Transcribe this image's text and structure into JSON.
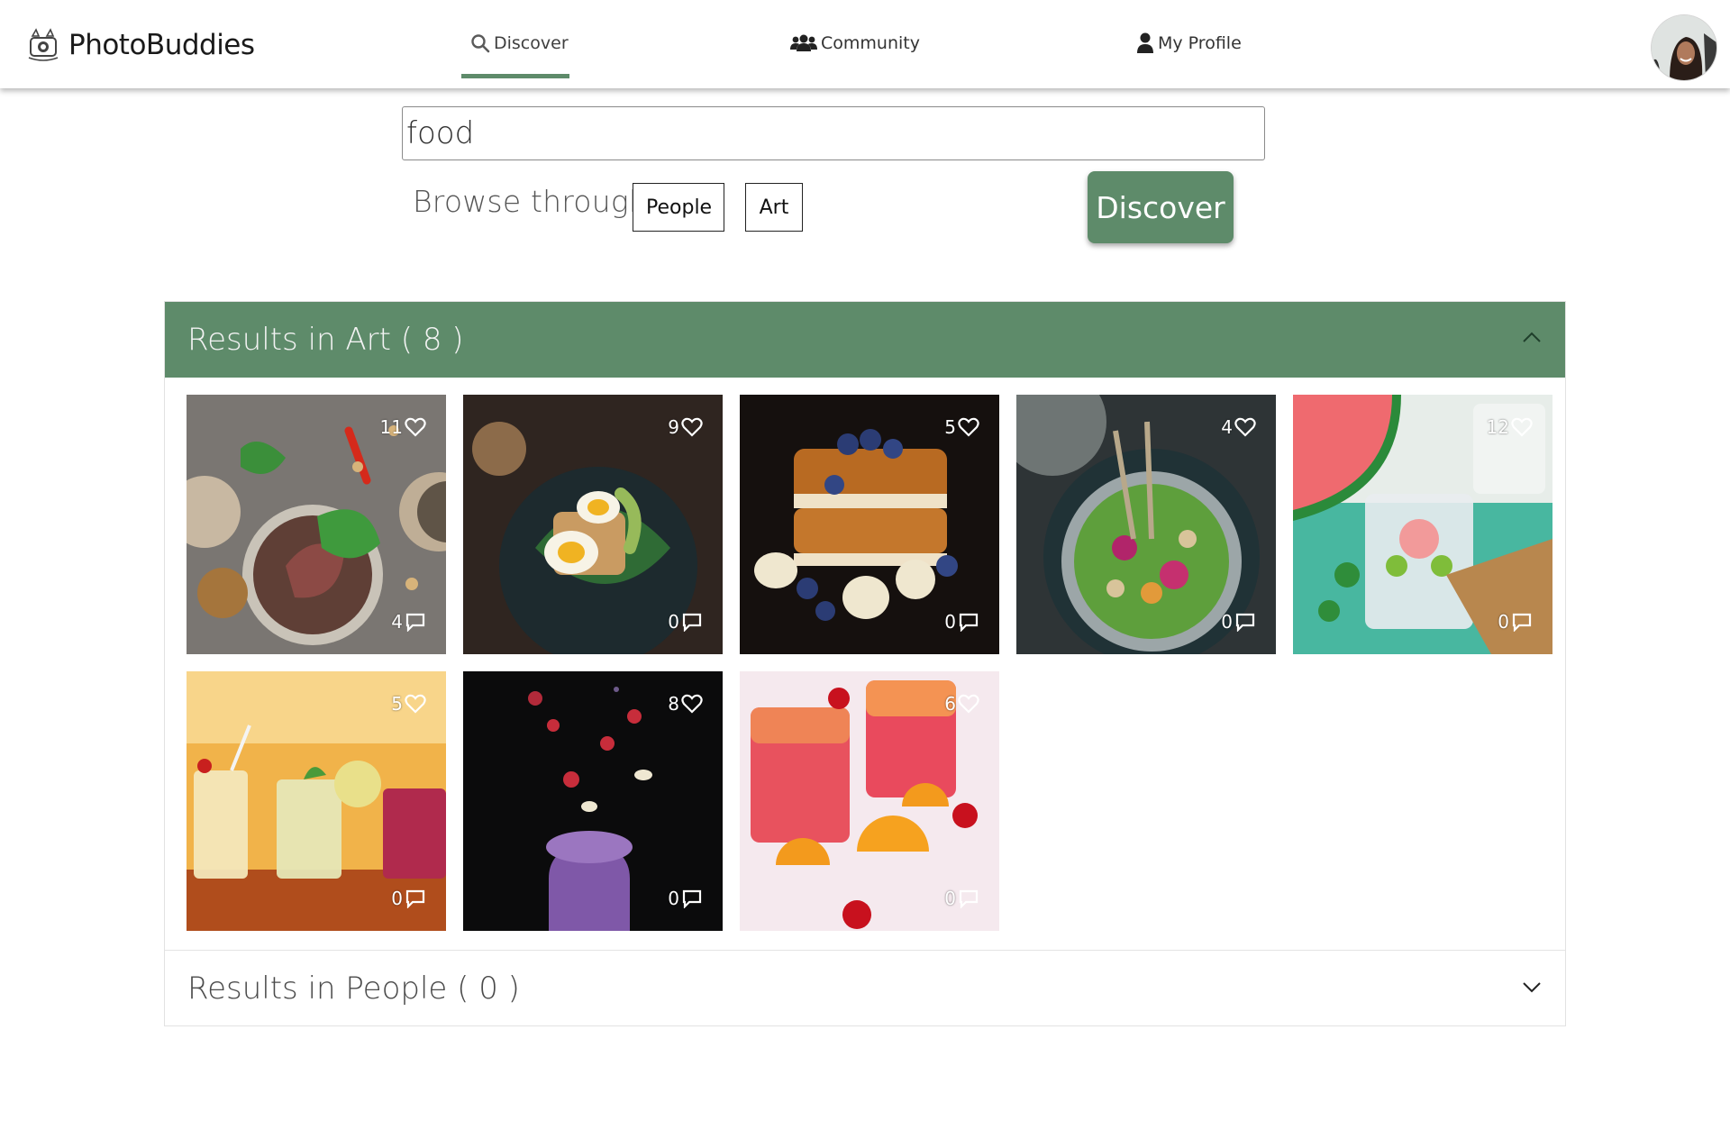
{
  "brand": {
    "name": "PhotoBuddies",
    "logo_icon": "camera-logo-icon"
  },
  "nav": {
    "items": [
      {
        "label": "Discover",
        "icon": "search-icon",
        "active": true
      },
      {
        "label": "Community",
        "icon": "users-icon",
        "active": false
      },
      {
        "label": "My Profile",
        "icon": "user-icon",
        "active": false
      }
    ],
    "accent_color": "#5e8b6a"
  },
  "search": {
    "value": "food",
    "browse_label": "Browse through",
    "filters": [
      "People",
      "Art"
    ],
    "discover_label": "Discover"
  },
  "results": {
    "art": {
      "title": "Results in Art ( 8 )",
      "expanded": true,
      "items": [
        {
          "likes": "11",
          "comments": "4",
          "subject": "steak-salad-bowls"
        },
        {
          "likes": "9",
          "comments": "0",
          "subject": "egg-avocado-toast"
        },
        {
          "likes": "5",
          "comments": "0",
          "subject": "french-toast-blueberries"
        },
        {
          "likes": "4",
          "comments": "0",
          "subject": "green-salad-bowl"
        },
        {
          "likes": "12",
          "comments": "0",
          "subject": "watermelon-drinks"
        },
        {
          "likes": "5",
          "comments": "0",
          "subject": "cocktail-glasses"
        },
        {
          "likes": "8",
          "comments": "0",
          "subject": "berry-smoothie-jar"
        },
        {
          "likes": "6",
          "comments": "0",
          "subject": "citrus-cherry-drinks"
        }
      ]
    },
    "people": {
      "title": "Results in People ( 0 )",
      "expanded": false
    }
  },
  "colors": {
    "header_green": "#5e8b6a",
    "heart": "#ffffff"
  }
}
